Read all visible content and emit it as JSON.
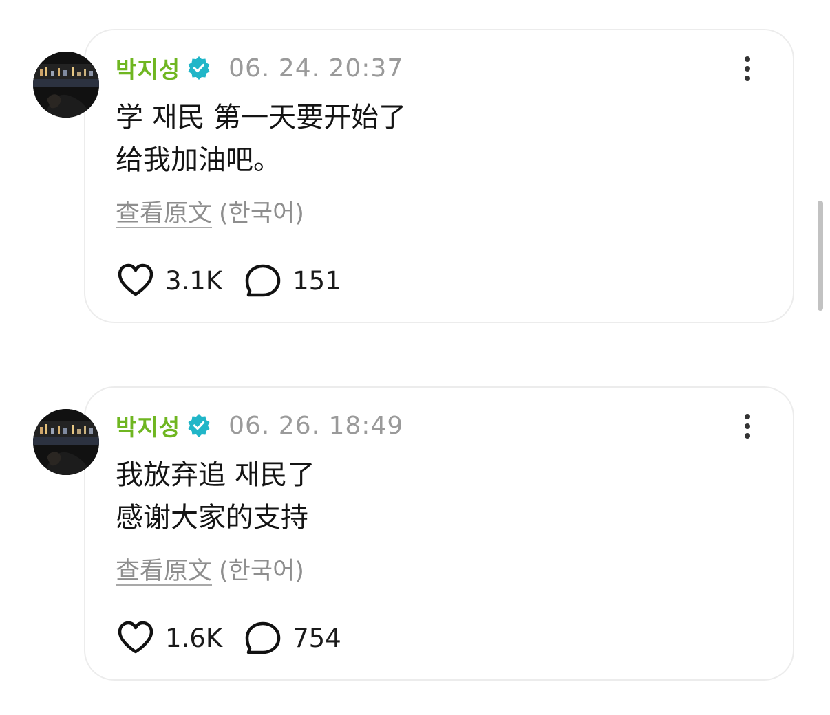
{
  "colors": {
    "username": "#6fb621",
    "verified_badge": "#21b6c8",
    "timestamp": "#9a9a9a",
    "card_border": "#ececec"
  },
  "posts": [
    {
      "username": "박지성",
      "timestamp": "06. 24. 20:37",
      "lines": [
        "学 재民 第一天要开始了",
        "给我加油吧。"
      ],
      "translate_link": "查看原文",
      "translate_lang": "(한국어)",
      "likes": "3.1K",
      "replies": "151",
      "icons": {
        "like": "heart-icon",
        "reply": "speech-bubble-icon",
        "more": "more-vertical-icon",
        "verified": "verified-badge-icon"
      }
    },
    {
      "username": "박지성",
      "timestamp": "06. 26. 18:49",
      "lines": [
        "我放弃追 재民了",
        "感谢大家的支持"
      ],
      "translate_link": "查看原文",
      "translate_lang": "(한국어)",
      "likes": "1.6K",
      "replies": "754",
      "icons": {
        "like": "heart-icon",
        "reply": "speech-bubble-icon",
        "more": "more-vertical-icon",
        "verified": "verified-badge-icon"
      }
    }
  ]
}
